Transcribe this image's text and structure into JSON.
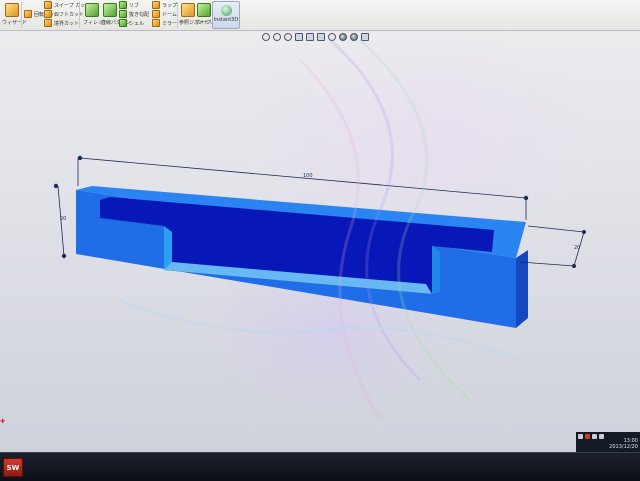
{
  "ribbon": {
    "wizard_label": "ウィザード",
    "items": [
      "回転カット",
      "スイープ カット",
      "ロフトカット",
      "境界カット",
      "フィレット",
      "直線パターン",
      "リブ",
      "抜き勾配",
      "シェル",
      "ラップ",
      "ドーム",
      "ミラー",
      "参照ジオメトリ",
      "カーブ"
    ],
    "instant3d_label": "Instant3D"
  },
  "model": {
    "face_color": "#1c5cf0",
    "pocket_color": "#0814b8",
    "dimensions": {
      "length": "100",
      "height": "20",
      "width": "20"
    }
  },
  "taskbar": {
    "app_icon": "solidworks-icon",
    "app_label": "SW",
    "clock_time": "13:00",
    "clock_date": "2013/12/20"
  }
}
